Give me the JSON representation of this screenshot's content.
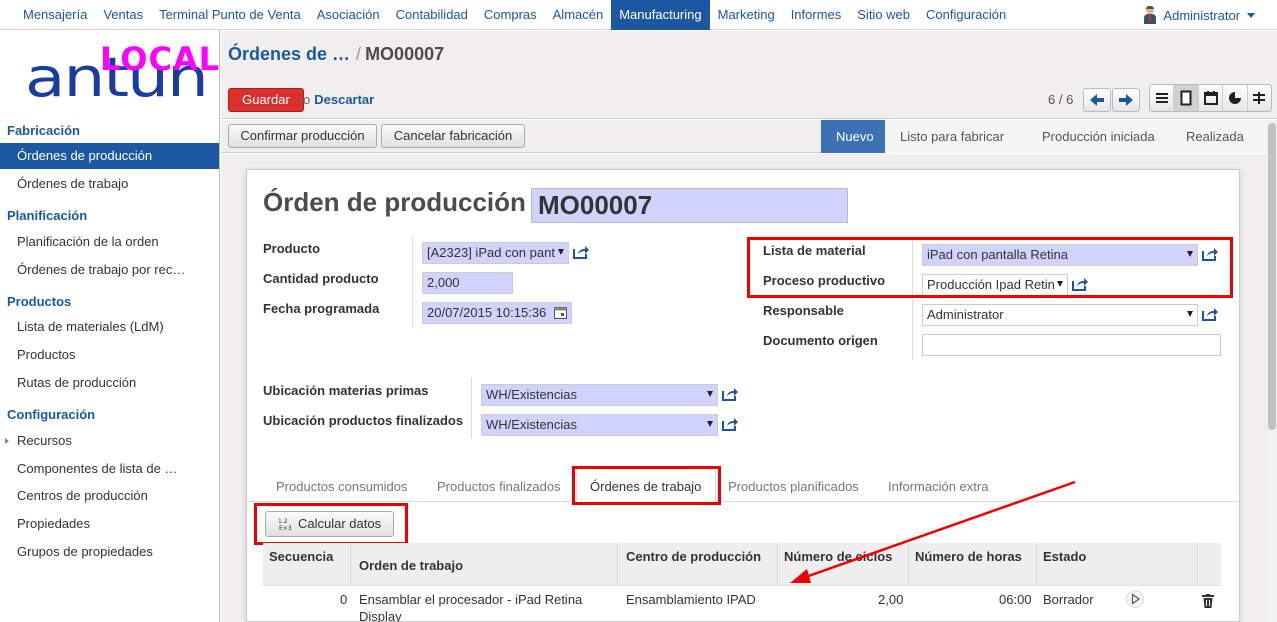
{
  "topnav": {
    "menu": [
      "Mensajería",
      "Ventas",
      "Terminal Punto de Venta",
      "Asociación",
      "Contabilidad",
      "Compras",
      "Almacén",
      "Manufacturing",
      "Marketing",
      "Informes",
      "Sitio web",
      "Configuración"
    ],
    "active_index": 7,
    "user": "Administrator"
  },
  "logo": {
    "overlay": "LOCAL",
    "brand": "antun"
  },
  "sidebar": {
    "sections": [
      {
        "title": "Fabricación",
        "items": [
          "Órdenes de producción",
          "Órdenes de trabajo"
        ]
      },
      {
        "title": "Planificación",
        "items": [
          "Planificación de la orden",
          "Órdenes de trabajo por rec…"
        ]
      },
      {
        "title": "Productos",
        "items": [
          "Lista de materiales (LdM)",
          "Productos",
          "Rutas de producción"
        ]
      },
      {
        "title": "Configuración",
        "items": [
          "Recursos",
          "Componentes de lista de …",
          "Centros de producción",
          "Propiedades",
          "Grupos de propiedades"
        ]
      }
    ],
    "active_item": "Órdenes de producción"
  },
  "breadcrumb": {
    "parent": "Órdenes de …",
    "separator": "/",
    "current": "MO00007"
  },
  "actions": {
    "save": "Guardar",
    "or": "o",
    "discard": "Descartar"
  },
  "pager": {
    "text": "6 / 6"
  },
  "status_buttons": {
    "confirm": "Confirmar producción",
    "cancel": "Cancelar fabricación"
  },
  "statusbar": {
    "steps": [
      "Nuevo",
      "Listo para fabricar",
      "Producción iniciada",
      "Realizada"
    ],
    "active_index": 0
  },
  "form": {
    "title": "Órden de producción",
    "name": "MO00007",
    "product_label": "Producto",
    "product_value": "[A2323] iPad con pant",
    "qty_label": "Cantidad producto",
    "qty_value": "2,000",
    "date_label": "Fecha programada",
    "date_value": "20/07/2015 10:15:36",
    "bom_label": "Lista de material",
    "bom_value": "iPad con pantalla Retina",
    "routing_label": "Proceso productivo",
    "routing_value": "Producción Ipad Retin",
    "resp_label": "Responsable",
    "resp_value": "Administrator",
    "origin_label": "Documento origen",
    "origin_value": "",
    "raw_loc_label": "Ubicación materias primas",
    "raw_loc_value": "WH/Existencias",
    "fin_loc_label": "Ubicación productos finalizados",
    "fin_loc_value": "WH/Existencias"
  },
  "tabs": [
    "Productos consumidos",
    "Productos finalizados",
    "Órdenes de trabajo",
    "Productos planificados",
    "Información extra"
  ],
  "active_tab": 2,
  "calc_button": "Calcular datos",
  "table": {
    "headers": [
      "Secuencia",
      "Orden de trabajo",
      "Centro de producción",
      "Número de ciclos",
      "Número de horas",
      "Estado"
    ],
    "rows": [
      {
        "seq": "0",
        "order": "Ensamblar el procesador - iPad Retina",
        "order_cont": "Display",
        "center": "Ensamblamiento IPAD",
        "cycles": "2,00",
        "hours": "06:00",
        "state": "Borrador"
      }
    ]
  },
  "colors": {
    "brand": "#1c58a2",
    "save": "#d9322e",
    "required_field": "#d2d2ff",
    "highlight": "#ee0000",
    "logo_overlay": "#ff00ff"
  },
  "icons": [
    "user-avatar-icon",
    "chevron-left-icon",
    "chevron-right-icon",
    "list-view-icon",
    "form-view-icon",
    "calendar-view-icon",
    "graph-view-icon",
    "gantt-view-icon",
    "external-link-icon",
    "calendar-picker-icon",
    "calculator-icon",
    "play-icon",
    "trash-icon"
  ]
}
